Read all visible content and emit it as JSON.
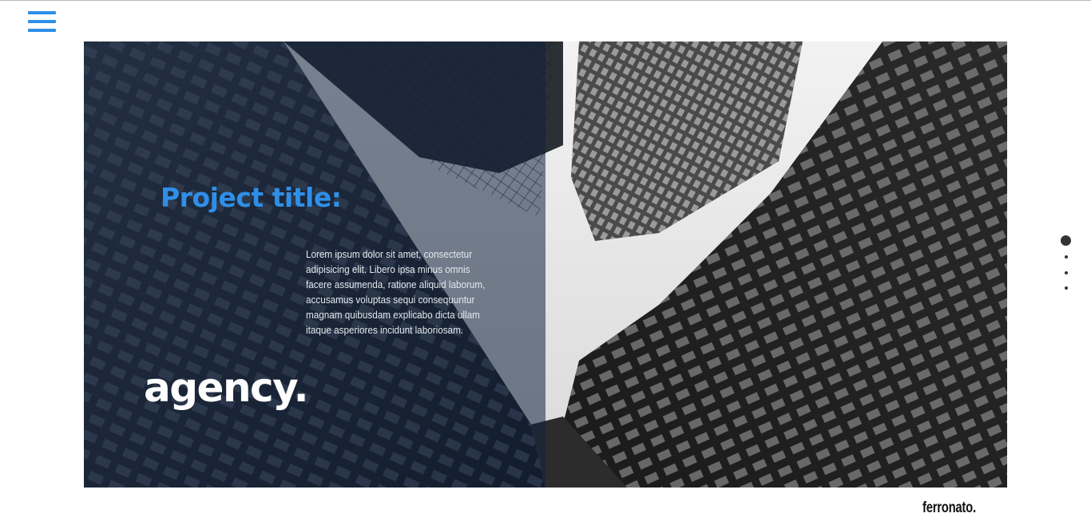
{
  "menu": {
    "icon": "hamburger-menu-icon"
  },
  "hero": {
    "image": "building-skyline-photo",
    "project_title": "Project title:",
    "body_text": "Lorem ipsum dolor sit amet, consectetur adipisicing elit. Libero ipsa minus omnis facere assumenda, ratione aliquid laborum, accusamus voluptas sequi consequuntur magnam quibusdam explicabo dicta ullam itaque asperiores incidunt laboriosam.",
    "tagline": "agency."
  },
  "pagination": {
    "count": 4,
    "active_index": 0
  },
  "footer": {
    "brand": "ferronato."
  },
  "colors": {
    "accent": "#2f8fe8",
    "overlay": "#10223e",
    "text_dark": "#111111",
    "dot": "#333333"
  }
}
